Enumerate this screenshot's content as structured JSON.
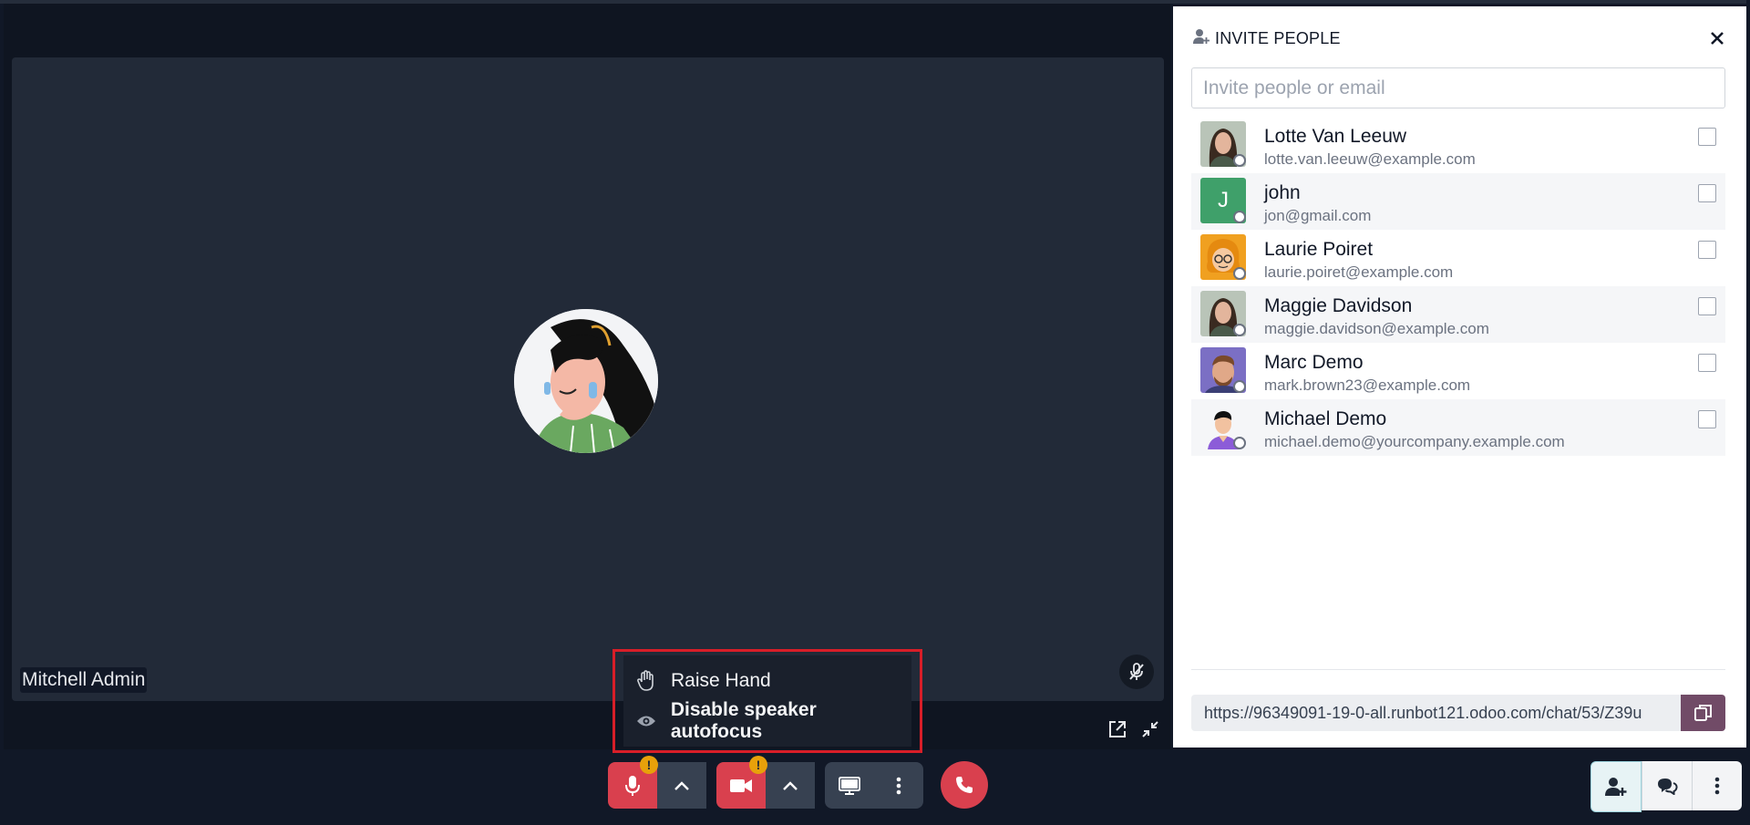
{
  "call": {
    "participant_name": "Mitchell Admin"
  },
  "menu": {
    "items": [
      {
        "label": "Raise Hand",
        "icon": "hand-icon"
      },
      {
        "label": "Disable speaker autofocus",
        "icon": "eye-icon"
      }
    ]
  },
  "controls": {
    "warning_badge": "!"
  },
  "invite": {
    "title": "INVITE PEOPLE",
    "search_placeholder": "Invite people or email",
    "people": [
      {
        "name": "Lotte Van Leeuw",
        "email": "lotte.van.leeuw@example.com"
      },
      {
        "name": "john",
        "email": "jon@gmail.com",
        "initial": "J"
      },
      {
        "name": "Laurie Poiret",
        "email": "laurie.poiret@example.com"
      },
      {
        "name": "Maggie Davidson",
        "email": "maggie.davidson@example.com"
      },
      {
        "name": "Marc Demo",
        "email": "mark.brown23@example.com"
      },
      {
        "name": "Michael Demo",
        "email": "michael.demo@yourcompany.example.com"
      }
    ],
    "invite_link": "https://96349091-19-0-all.runbot121.odoo.com/chat/53/Z39u"
  },
  "colors": {
    "accent_red": "#d9404e",
    "brand_purple": "#714b67",
    "warning": "#e8a10a"
  }
}
